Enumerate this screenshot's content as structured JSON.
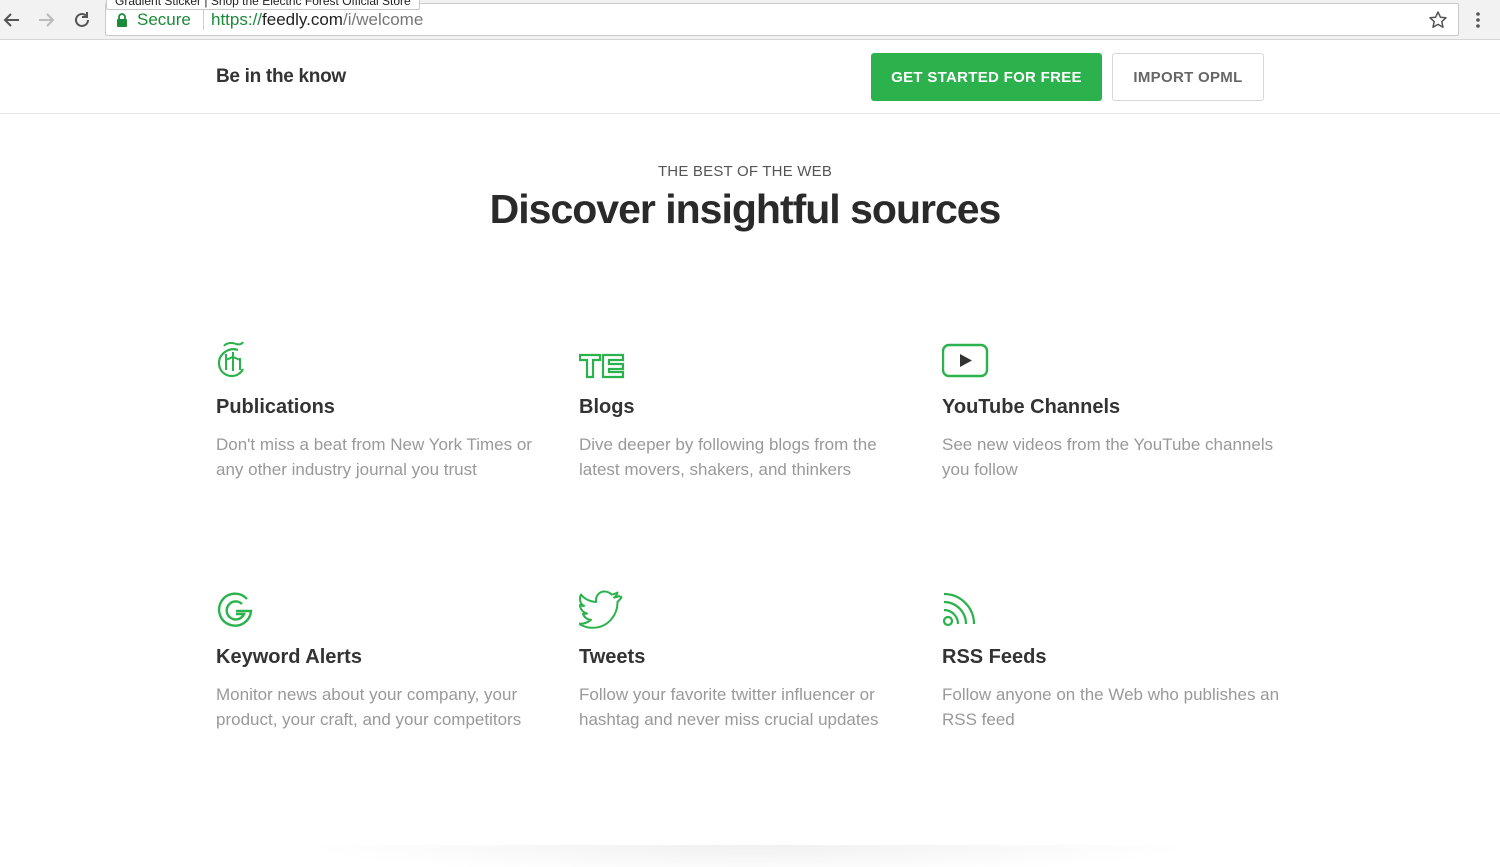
{
  "browser": {
    "tooltip": "Gradient Sticker | Shop the Electric Forest Official Store",
    "secure_label": "Secure",
    "url_scheme": "https://",
    "url_host": "feedly.com",
    "url_path": "/i/welcome"
  },
  "header": {
    "brand": "Be in the know",
    "primary_button": "GET STARTED FOR FREE",
    "secondary_button": "IMPORT OPML"
  },
  "hero": {
    "eyebrow": "THE BEST OF THE WEB",
    "title": "Discover insightful sources"
  },
  "features": [
    {
      "icon": "nyt-icon",
      "title": "Publications",
      "description": "Don't miss a beat from New York Times or any other industry journal you trust"
    },
    {
      "icon": "techcrunch-icon",
      "title": "Blogs",
      "description": "Dive deeper by following blogs from the latest movers, shakers, and thinkers"
    },
    {
      "icon": "youtube-icon",
      "title": "YouTube Channels",
      "description": "See new videos from the YouTube channels you follow"
    },
    {
      "icon": "google-icon",
      "title": "Keyword Alerts",
      "description": "Monitor news about your company, your product, your craft, and your competitors"
    },
    {
      "icon": "twitter-icon",
      "title": "Tweets",
      "description": "Follow your favorite twitter influencer or hashtag and never miss crucial updates"
    },
    {
      "icon": "rss-icon",
      "title": "RSS Feeds",
      "description": "Follow anyone on the Web who publishes an RSS feed"
    }
  ],
  "colors": {
    "accent": "#2bb24c",
    "secure": "#1b8a3a",
    "description_text": "#999999"
  }
}
